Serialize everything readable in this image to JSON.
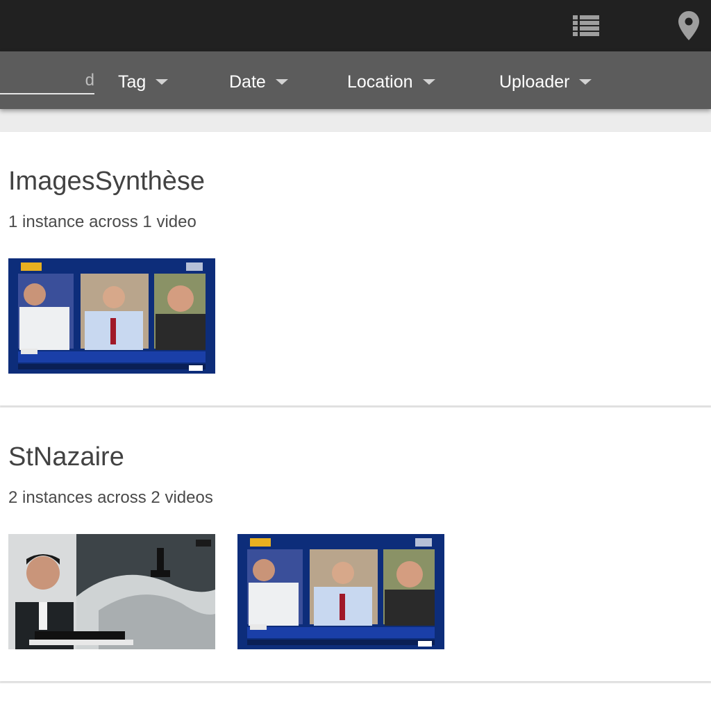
{
  "topbar": {
    "icons": [
      "list-icon",
      "map-pin-icon"
    ]
  },
  "filters": {
    "search_placeholder": "d",
    "tag_label": "Tag",
    "date_label": "Date",
    "location_label": "Location",
    "uploader_label": "Uploader"
  },
  "tags": [
    {
      "name": "ImagesSynthèse",
      "count_text": "1 instance across 1 video",
      "thumbnails": [
        "news-panel-video-thumbnail"
      ]
    },
    {
      "name": "StNazaire",
      "count_text": "2 instances across 2 videos",
      "thumbnails": [
        "submarine-report-video-thumbnail",
        "news-panel-video-thumbnail"
      ]
    }
  ],
  "colors": {
    "topbar": "#212121",
    "filterbar": "#5c5c5c",
    "card": "#ffffff",
    "page": "#ececec"
  }
}
